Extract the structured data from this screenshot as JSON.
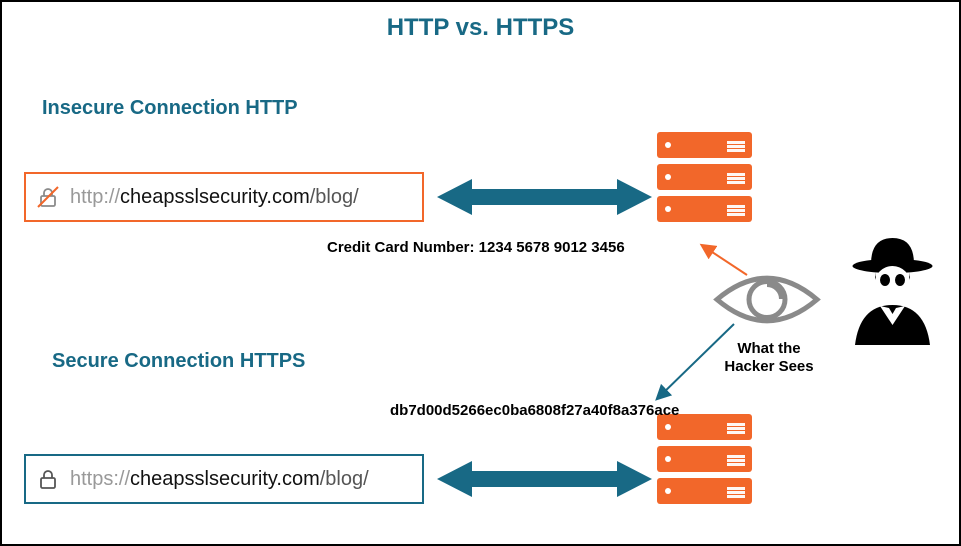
{
  "title": "HTTP vs. HTTPS",
  "sections": {
    "http": {
      "label": "Insecure Connection HTTP",
      "url_plain": "http://cheapsslsecurity.com/blog/",
      "url_scheme": "http://",
      "url_host": "cheapsslsecurity.com",
      "url_path": "/blog/"
    },
    "https": {
      "label": "Secure Connection HTTPS",
      "url_plain": "https://cheapsslsecurity.com/blog/",
      "url_scheme": "https://",
      "url_host": "cheapsslsecurity.com",
      "url_path": "/blog/"
    }
  },
  "payloads": {
    "plaintext": "Credit Card Number: 1234 5678 9012 3456",
    "ciphertext": "db7d00d5266ec0ba6808f27a40f8a376ace"
  },
  "hacker": {
    "label": "What the Hacker Sees"
  },
  "colors": {
    "teal": "#186985",
    "orange": "#f2672a",
    "grey": "#8a8a8a"
  }
}
